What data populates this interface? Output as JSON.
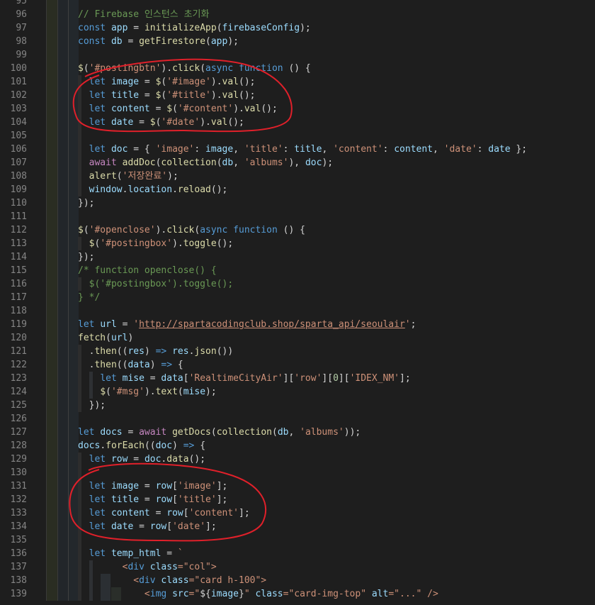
{
  "colors": {
    "background": "#1e1e1e",
    "line_number": "#858585",
    "comment": "#6a9955",
    "keyword": "#569cd6",
    "variable": "#9cdcfe",
    "function": "#dcdcaa",
    "string": "#ce9178",
    "number": "#b5cea8",
    "annotation": "#e0202a"
  },
  "line_numbers": [
    "95",
    "96",
    "97",
    "98",
    "99",
    "100",
    "101",
    "102",
    "103",
    "104",
    "105",
    "106",
    "107",
    "108",
    "109",
    "110",
    "111",
    "112",
    "113",
    "114",
    "115",
    "116",
    "117",
    "118",
    "119",
    "120",
    "121",
    "122",
    "123",
    "124",
    "125",
    "126",
    "127",
    "128",
    "129",
    "130",
    "131",
    "132",
    "133",
    "134",
    "135",
    "136",
    "137",
    "138",
    "139"
  ],
  "code_lines": [
    [],
    [
      [
        "cm",
        "// Firebase 인스턴스 초기화"
      ]
    ],
    [
      [
        "kw",
        "const"
      ],
      [
        "pct",
        " "
      ],
      [
        "var",
        "app"
      ],
      [
        "pct",
        " = "
      ],
      [
        "fn",
        "initializeApp"
      ],
      [
        "pct",
        "("
      ],
      [
        "var",
        "firebaseConfig"
      ],
      [
        "pct",
        ");"
      ]
    ],
    [
      [
        "kw",
        "const"
      ],
      [
        "pct",
        " "
      ],
      [
        "var",
        "db"
      ],
      [
        "pct",
        " = "
      ],
      [
        "fn",
        "getFirestore"
      ],
      [
        "pct",
        "("
      ],
      [
        "var",
        "app"
      ],
      [
        "pct",
        ");"
      ]
    ],
    [],
    [
      [
        "fn",
        "$"
      ],
      [
        "pct",
        "("
      ],
      [
        "str",
        "'#postingbtn'"
      ],
      [
        "pct",
        ")."
      ],
      [
        "fn",
        "click"
      ],
      [
        "pct",
        "("
      ],
      [
        "kw",
        "async"
      ],
      [
        "pct",
        " "
      ],
      [
        "kw",
        "function"
      ],
      [
        "pct",
        " () {"
      ]
    ],
    [
      [
        "pct",
        "  "
      ],
      [
        "kw",
        "let"
      ],
      [
        "pct",
        " "
      ],
      [
        "var",
        "image"
      ],
      [
        "pct",
        " = "
      ],
      [
        "fn",
        "$"
      ],
      [
        "pct",
        "("
      ],
      [
        "str",
        "'#image'"
      ],
      [
        "pct",
        ")."
      ],
      [
        "fn",
        "val"
      ],
      [
        "pct",
        "();"
      ]
    ],
    [
      [
        "pct",
        "  "
      ],
      [
        "kw",
        "let"
      ],
      [
        "pct",
        " "
      ],
      [
        "var",
        "title"
      ],
      [
        "pct",
        " = "
      ],
      [
        "fn",
        "$"
      ],
      [
        "pct",
        "("
      ],
      [
        "str",
        "'#title'"
      ],
      [
        "pct",
        ")."
      ],
      [
        "fn",
        "val"
      ],
      [
        "pct",
        "();"
      ]
    ],
    [
      [
        "pct",
        "  "
      ],
      [
        "kw",
        "let"
      ],
      [
        "pct",
        " "
      ],
      [
        "var",
        "content"
      ],
      [
        "pct",
        " = "
      ],
      [
        "fn",
        "$"
      ],
      [
        "pct",
        "("
      ],
      [
        "str",
        "'#content'"
      ],
      [
        "pct",
        ")."
      ],
      [
        "fn",
        "val"
      ],
      [
        "pct",
        "();"
      ]
    ],
    [
      [
        "pct",
        "  "
      ],
      [
        "kw",
        "let"
      ],
      [
        "pct",
        " "
      ],
      [
        "var",
        "date"
      ],
      [
        "pct",
        " = "
      ],
      [
        "fn",
        "$"
      ],
      [
        "pct",
        "("
      ],
      [
        "str",
        "'#date'"
      ],
      [
        "pct",
        ")."
      ],
      [
        "fn",
        "val"
      ],
      [
        "pct",
        "();"
      ]
    ],
    [],
    [
      [
        "pct",
        "  "
      ],
      [
        "kw",
        "let"
      ],
      [
        "pct",
        " "
      ],
      [
        "var",
        "doc"
      ],
      [
        "pct",
        " = { "
      ],
      [
        "str",
        "'image'"
      ],
      [
        "pct",
        ": "
      ],
      [
        "var",
        "image"
      ],
      [
        "pct",
        ", "
      ],
      [
        "str",
        "'title'"
      ],
      [
        "pct",
        ": "
      ],
      [
        "var",
        "title"
      ],
      [
        "pct",
        ", "
      ],
      [
        "str",
        "'content'"
      ],
      [
        "pct",
        ": "
      ],
      [
        "var",
        "content"
      ],
      [
        "pct",
        ", "
      ],
      [
        "str",
        "'date'"
      ],
      [
        "pct",
        ": "
      ],
      [
        "var",
        "date"
      ],
      [
        "pct",
        " };"
      ]
    ],
    [
      [
        "pct",
        "  "
      ],
      [
        "ctl",
        "await"
      ],
      [
        "pct",
        " "
      ],
      [
        "fn",
        "addDoc"
      ],
      [
        "pct",
        "("
      ],
      [
        "fn",
        "collection"
      ],
      [
        "pct",
        "("
      ],
      [
        "var",
        "db"
      ],
      [
        "pct",
        ", "
      ],
      [
        "str",
        "'albums'"
      ],
      [
        "pct",
        "), "
      ],
      [
        "var",
        "doc"
      ],
      [
        "pct",
        ");"
      ]
    ],
    [
      [
        "pct",
        "  "
      ],
      [
        "fn",
        "alert"
      ],
      [
        "pct",
        "("
      ],
      [
        "str",
        "'저장완료'"
      ],
      [
        "pct",
        ");"
      ]
    ],
    [
      [
        "pct",
        "  "
      ],
      [
        "var",
        "window"
      ],
      [
        "pct",
        "."
      ],
      [
        "var",
        "location"
      ],
      [
        "pct",
        "."
      ],
      [
        "fn",
        "reload"
      ],
      [
        "pct",
        "();"
      ]
    ],
    [
      [
        "pct",
        "});"
      ]
    ],
    [],
    [
      [
        "fn",
        "$"
      ],
      [
        "pct",
        "("
      ],
      [
        "str",
        "'#openclose'"
      ],
      [
        "pct",
        ")."
      ],
      [
        "fn",
        "click"
      ],
      [
        "pct",
        "("
      ],
      [
        "kw",
        "async"
      ],
      [
        "pct",
        " "
      ],
      [
        "kw",
        "function"
      ],
      [
        "pct",
        " () {"
      ]
    ],
    [
      [
        "pct",
        "  "
      ],
      [
        "fn",
        "$"
      ],
      [
        "pct",
        "("
      ],
      [
        "str",
        "'#postingbox'"
      ],
      [
        "pct",
        ")."
      ],
      [
        "fn",
        "toggle"
      ],
      [
        "pct",
        "();"
      ]
    ],
    [
      [
        "pct",
        "});"
      ]
    ],
    [
      [
        "cm",
        "/* function openclose() {"
      ]
    ],
    [
      [
        "cm",
        "  $('#postingbox').toggle();"
      ]
    ],
    [
      [
        "cm",
        "} */"
      ]
    ],
    [],
    [
      [
        "kw",
        "let"
      ],
      [
        "pct",
        " "
      ],
      [
        "var",
        "url"
      ],
      [
        "pct",
        " = "
      ],
      [
        "str",
        "'"
      ],
      [
        "url",
        "http://spartacodingclub.shop/sparta_api/seoulair"
      ],
      [
        "str",
        "'"
      ],
      [
        "pct",
        ";"
      ]
    ],
    [
      [
        "fn",
        "fetch"
      ],
      [
        "pct",
        "("
      ],
      [
        "var",
        "url"
      ],
      [
        "pct",
        ")"
      ]
    ],
    [
      [
        "pct",
        "  ."
      ],
      [
        "fn",
        "then"
      ],
      [
        "pct",
        "(("
      ],
      [
        "var",
        "res"
      ],
      [
        "pct",
        ") "
      ],
      [
        "kw",
        "=>"
      ],
      [
        "pct",
        " "
      ],
      [
        "var",
        "res"
      ],
      [
        "pct",
        "."
      ],
      [
        "fn",
        "json"
      ],
      [
        "pct",
        "())"
      ]
    ],
    [
      [
        "pct",
        "  ."
      ],
      [
        "fn",
        "then"
      ],
      [
        "pct",
        "(("
      ],
      [
        "var",
        "data"
      ],
      [
        "pct",
        ") "
      ],
      [
        "kw",
        "=>"
      ],
      [
        "pct",
        " {"
      ]
    ],
    [
      [
        "pct",
        "    "
      ],
      [
        "kw",
        "let"
      ],
      [
        "pct",
        " "
      ],
      [
        "var",
        "mise"
      ],
      [
        "pct",
        " = "
      ],
      [
        "var",
        "data"
      ],
      [
        "pct",
        "["
      ],
      [
        "str",
        "'RealtimeCityAir'"
      ],
      [
        "pct",
        "]["
      ],
      [
        "str",
        "'row'"
      ],
      [
        "pct",
        "]["
      ],
      [
        "num",
        "0"
      ],
      [
        "pct",
        "]["
      ],
      [
        "str",
        "'IDEX_NM'"
      ],
      [
        "pct",
        "];"
      ]
    ],
    [
      [
        "pct",
        "    "
      ],
      [
        "fn",
        "$"
      ],
      [
        "pct",
        "("
      ],
      [
        "str",
        "'#msg'"
      ],
      [
        "pct",
        ")."
      ],
      [
        "fn",
        "text"
      ],
      [
        "pct",
        "("
      ],
      [
        "var",
        "mise"
      ],
      [
        "pct",
        ");"
      ]
    ],
    [
      [
        "pct",
        "  });"
      ]
    ],
    [],
    [
      [
        "kw",
        "let"
      ],
      [
        "pct",
        " "
      ],
      [
        "var",
        "docs"
      ],
      [
        "pct",
        " = "
      ],
      [
        "ctl",
        "await"
      ],
      [
        "pct",
        " "
      ],
      [
        "fn",
        "getDocs"
      ],
      [
        "pct",
        "("
      ],
      [
        "fn",
        "collection"
      ],
      [
        "pct",
        "("
      ],
      [
        "var",
        "db"
      ],
      [
        "pct",
        ", "
      ],
      [
        "str",
        "'albums'"
      ],
      [
        "pct",
        "));"
      ]
    ],
    [
      [
        "var",
        "docs"
      ],
      [
        "pct",
        "."
      ],
      [
        "fn",
        "forEach"
      ],
      [
        "pct",
        "(("
      ],
      [
        "var",
        "doc"
      ],
      [
        "pct",
        ") "
      ],
      [
        "kw",
        "=>"
      ],
      [
        "pct",
        " {"
      ]
    ],
    [
      [
        "pct",
        "  "
      ],
      [
        "kw",
        "let"
      ],
      [
        "pct",
        " "
      ],
      [
        "var",
        "row"
      ],
      [
        "pct",
        " = "
      ],
      [
        "var",
        "doc"
      ],
      [
        "pct",
        "."
      ],
      [
        "fn",
        "data"
      ],
      [
        "pct",
        "();"
      ]
    ],
    [],
    [
      [
        "pct",
        "  "
      ],
      [
        "kw",
        "let"
      ],
      [
        "pct",
        " "
      ],
      [
        "var",
        "image"
      ],
      [
        "pct",
        " = "
      ],
      [
        "var",
        "row"
      ],
      [
        "pct",
        "["
      ],
      [
        "str",
        "'image'"
      ],
      [
        "pct",
        "];"
      ]
    ],
    [
      [
        "pct",
        "  "
      ],
      [
        "kw",
        "let"
      ],
      [
        "pct",
        " "
      ],
      [
        "var",
        "title"
      ],
      [
        "pct",
        " = "
      ],
      [
        "var",
        "row"
      ],
      [
        "pct",
        "["
      ],
      [
        "str",
        "'title'"
      ],
      [
        "pct",
        "];"
      ]
    ],
    [
      [
        "pct",
        "  "
      ],
      [
        "kw",
        "let"
      ],
      [
        "pct",
        " "
      ],
      [
        "var",
        "content"
      ],
      [
        "pct",
        " = "
      ],
      [
        "var",
        "row"
      ],
      [
        "pct",
        "["
      ],
      [
        "str",
        "'content'"
      ],
      [
        "pct",
        "];"
      ]
    ],
    [
      [
        "pct",
        "  "
      ],
      [
        "kw",
        "let"
      ],
      [
        "pct",
        " "
      ],
      [
        "var",
        "date"
      ],
      [
        "pct",
        " = "
      ],
      [
        "var",
        "row"
      ],
      [
        "pct",
        "["
      ],
      [
        "str",
        "'date'"
      ],
      [
        "pct",
        "];"
      ]
    ],
    [],
    [
      [
        "pct",
        "  "
      ],
      [
        "kw",
        "let"
      ],
      [
        "pct",
        " "
      ],
      [
        "var",
        "temp_html"
      ],
      [
        "pct",
        " = "
      ],
      [
        "str",
        "`"
      ]
    ],
    [
      [
        "pct",
        "        "
      ],
      [
        "str",
        "<"
      ],
      [
        "tag",
        "div"
      ],
      [
        "str",
        " "
      ],
      [
        "attr",
        "class"
      ],
      [
        "str",
        "=\"col\">"
      ]
    ],
    [
      [
        "pct",
        "          "
      ],
      [
        "str",
        "<"
      ],
      [
        "tag",
        "div"
      ],
      [
        "str",
        " "
      ],
      [
        "attr",
        "class"
      ],
      [
        "str",
        "=\"card h-100\">"
      ]
    ],
    [
      [
        "pct",
        "            "
      ],
      [
        "str",
        "<"
      ],
      [
        "tag",
        "img"
      ],
      [
        "str",
        " "
      ],
      [
        "attr",
        "src"
      ],
      [
        "str",
        "=\""
      ],
      [
        "pct",
        "${"
      ],
      [
        "var",
        "image"
      ],
      [
        "pct",
        "}"
      ],
      [
        "str",
        "\" "
      ],
      [
        "attr",
        "class"
      ],
      [
        "str",
        "=\"card-img-top\" "
      ],
      [
        "attr",
        "alt"
      ],
      [
        "str",
        "=\"...\" />"
      ]
    ]
  ]
}
